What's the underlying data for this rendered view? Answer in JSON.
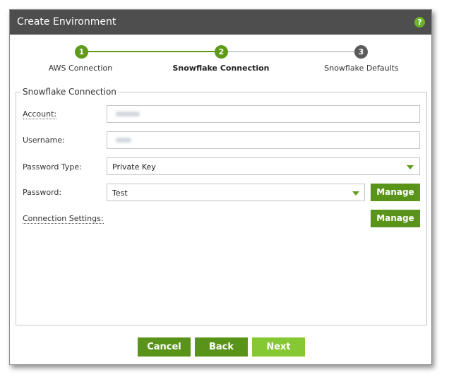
{
  "dialog": {
    "title": "Create Environment",
    "help_icon": "question-circle-icon"
  },
  "stepper": {
    "steps": [
      {
        "number": "1",
        "label": "AWS Connection",
        "state": "completed"
      },
      {
        "number": "2",
        "label": "Snowflake Connection",
        "state": "active"
      },
      {
        "number": "3",
        "label": "Snowflake Defaults",
        "state": "pending"
      }
    ]
  },
  "form": {
    "legend": "Snowflake Connection",
    "account": {
      "label": "Account:"
    },
    "username": {
      "label": "Username:"
    },
    "password_type": {
      "label": "Password Type:",
      "value": "Private Key"
    },
    "password": {
      "label": "Password:",
      "value": "Test",
      "manage_label": "Manage"
    },
    "connection_settings": {
      "label": "Connection Settings:",
      "manage_label": "Manage"
    }
  },
  "footer": {
    "cancel_label": "Cancel",
    "back_label": "Back",
    "next_label": "Next"
  },
  "colors": {
    "titlebar": "#4e4e4e",
    "accent_green": "#5a9319",
    "next_green": "#86c734",
    "pending_gray": "#5a5a5a"
  }
}
